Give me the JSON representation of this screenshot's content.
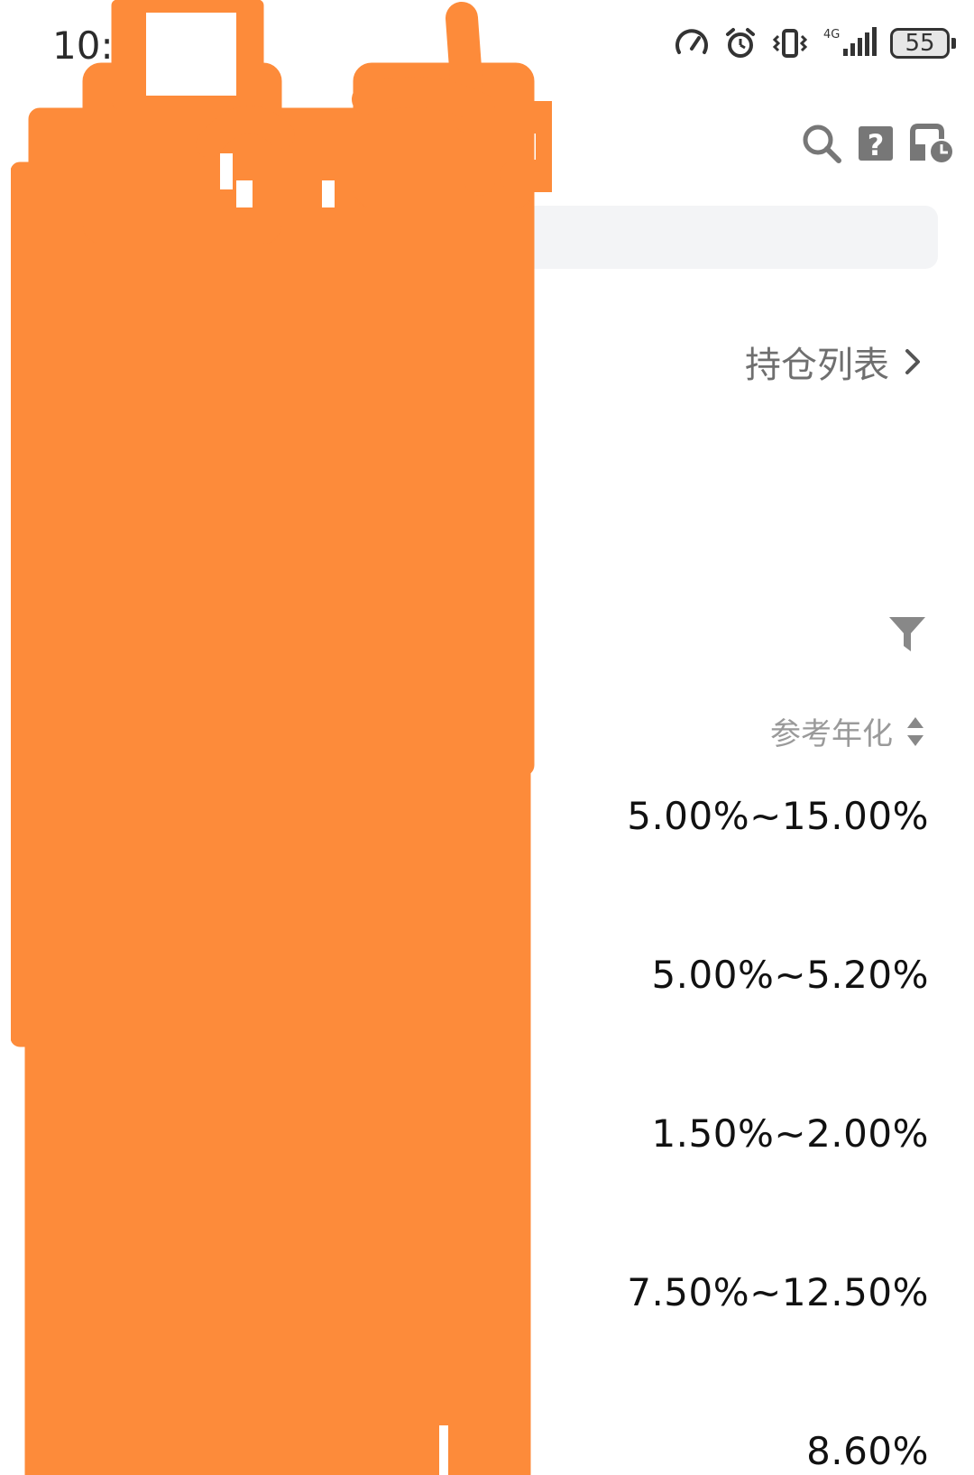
{
  "status_bar": {
    "time": "10:53",
    "battery": "55",
    "network": "4G"
  },
  "toolbar": {
    "search_icon": "search-icon",
    "help_icon": "help-icon",
    "history_icon": "history-icon"
  },
  "holdings": {
    "link_label": "持仓列表"
  },
  "list": {
    "sort_label": "参考年化",
    "yields": [
      "5.00%~15.00%",
      "5.00%~5.20%",
      "1.50%~2.00%",
      "7.50%~12.50%",
      "8.60%"
    ]
  },
  "colors": {
    "redaction": "#fd8b3a",
    "muted_text": "#6f6f6f",
    "search_bg": "#f3f4f6"
  }
}
